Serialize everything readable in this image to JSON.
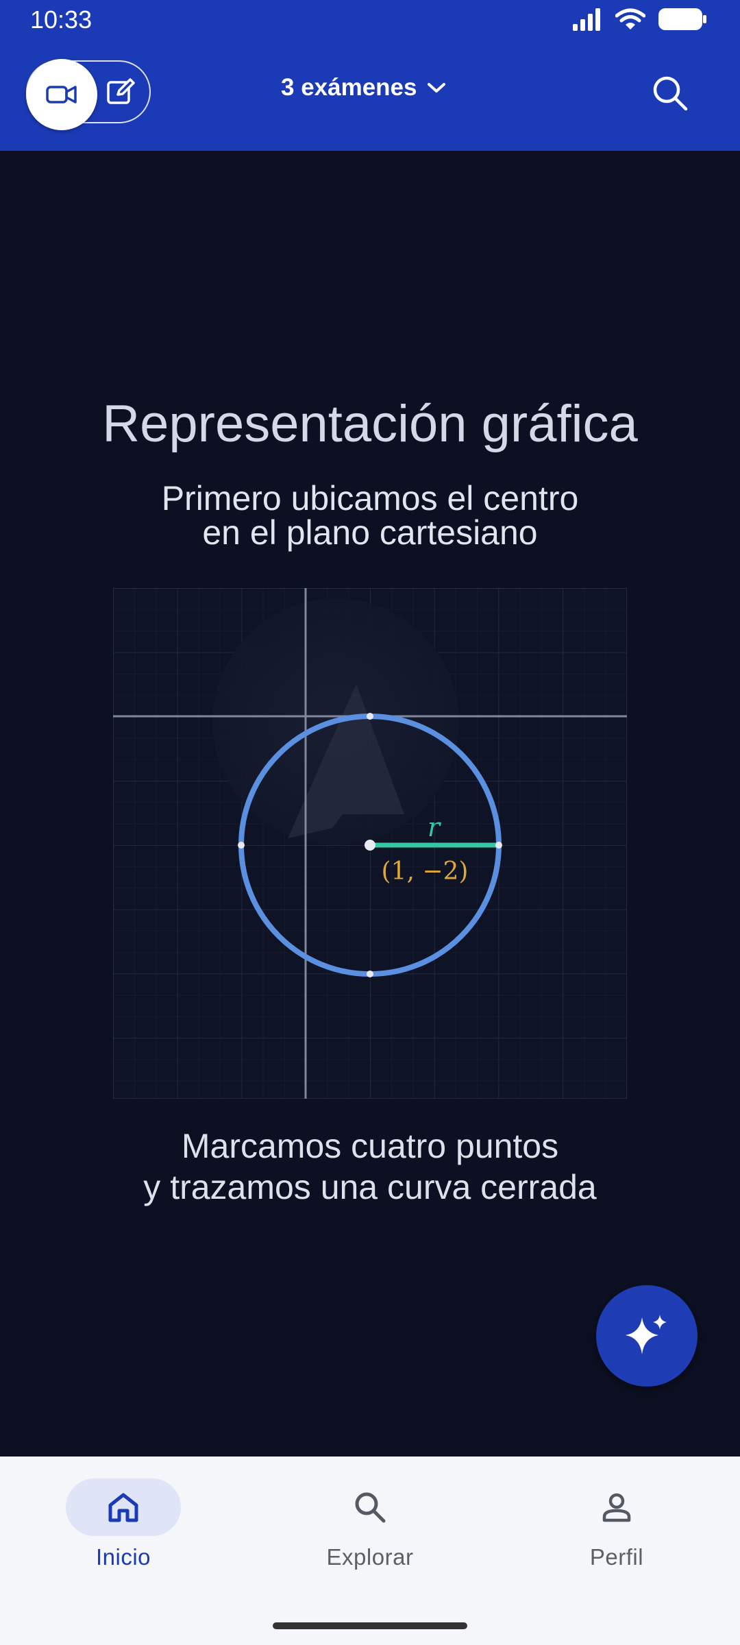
{
  "status": {
    "time": "10:33"
  },
  "header": {
    "title": "3 exámenes"
  },
  "lesson": {
    "heading": "Representación gráfica",
    "subtitle_line1": "Primero ubicamos el centro",
    "subtitle_line2": "en el plano cartesiano",
    "caption_line1": "Marcamos cuatro puntos",
    "caption_line2": "y trazamos una curva cerrada"
  },
  "graph": {
    "center_label": "(1, −2)",
    "radius_label": "r",
    "colors": {
      "circle": "#5b8fe0",
      "radius": "#33c9a4",
      "center_label": "#e0a83a",
      "axes": "#8a93a8"
    }
  },
  "nav": {
    "items": [
      {
        "label": "Inicio",
        "icon": "home-icon",
        "active": true
      },
      {
        "label": "Explorar",
        "icon": "search-icon",
        "active": false
      },
      {
        "label": "Perfil",
        "icon": "person-icon",
        "active": false
      }
    ]
  },
  "colors": {
    "brand": "#1b3ab6",
    "background": "#0c1022",
    "nav_bg": "#f5f6f9"
  }
}
